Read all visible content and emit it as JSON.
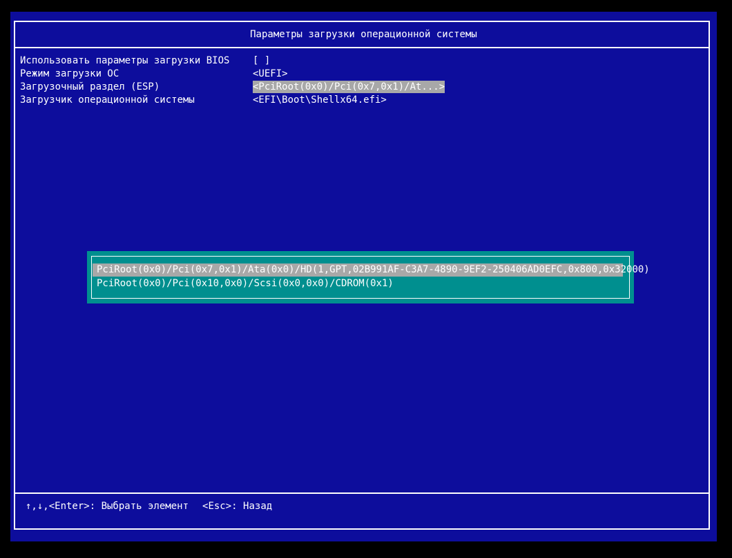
{
  "header": {
    "title": "Параметры загрузки операционной системы"
  },
  "options": [
    {
      "label": "Использовать параметры загрузки BIOS",
      "value": "[ ]"
    },
    {
      "label": "Режим загрузки ОС",
      "value": "<UEFI>"
    },
    {
      "label": "Загрузочный раздел (ESP)",
      "value": "<PciRoot(0x0)/Pci(0x7,0x1)/At...>",
      "selected": true
    },
    {
      "label": "Загрузчик операционной системы",
      "value": "<EFI\\Boot\\Shellx64.efi>"
    }
  ],
  "popup": {
    "items": [
      {
        "text": "PciRoot(0x0)/Pci(0x7,0x1)/Ata(0x0)/HD(1,GPT,02B991AF-C3A7-4890-9EF2-250406AD0EFC,0x800,0x32000)",
        "selected": true
      },
      {
        "text": "PciRoot(0x0)/Pci(0x10,0x0)/Scsi(0x0,0x0)/CDROM(0x1)"
      }
    ]
  },
  "footer": {
    "nav_keys": "↑,↓,<Enter>",
    "nav_action": ": Выбрать элемент",
    "back_key": "<Esc>",
    "back_action": ": Назад"
  },
  "colors": {
    "background": "#0d0d9c",
    "popup_background": "#008f8f",
    "highlight": "#a8a8a8",
    "text": "#ffffff"
  }
}
